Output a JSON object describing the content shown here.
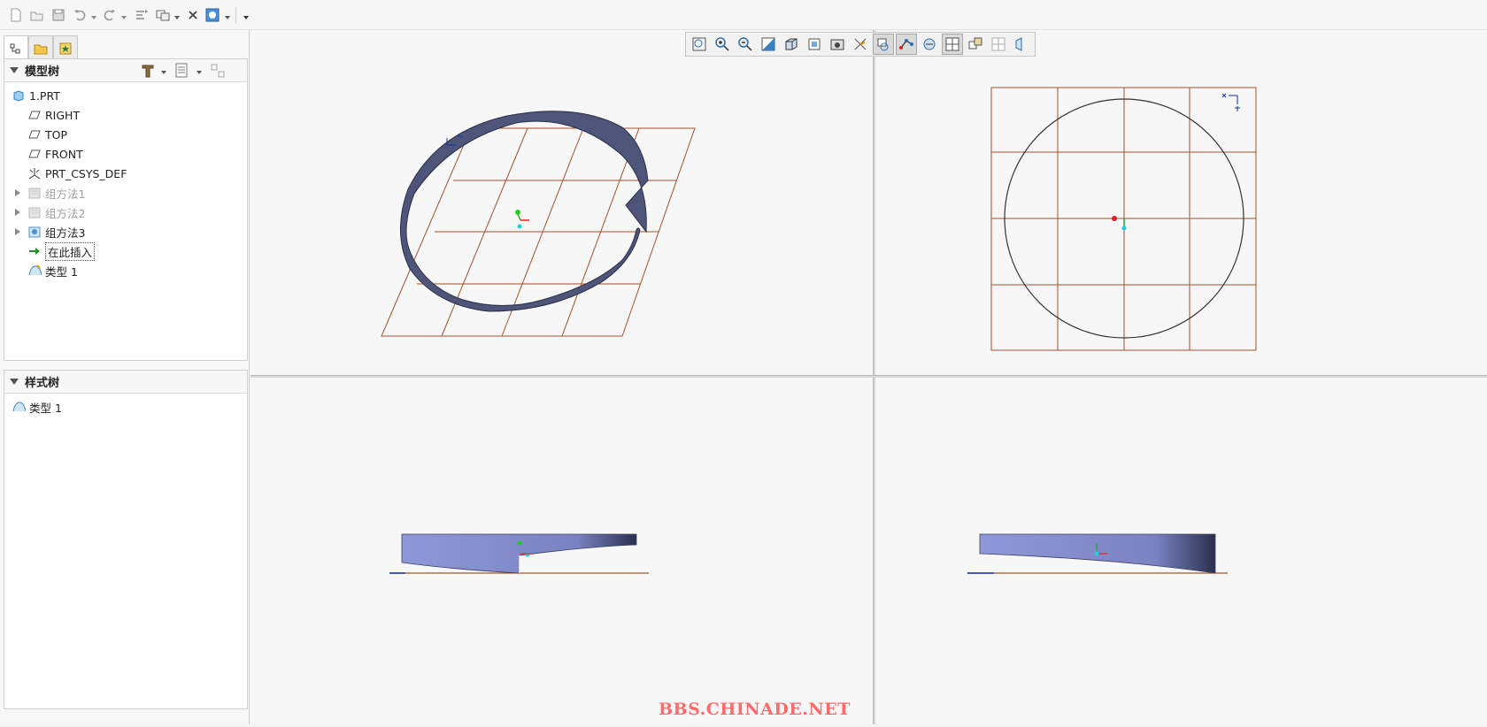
{
  "quick_access": {
    "icons": [
      "new-icon",
      "open-icon",
      "save-icon",
      "undo-icon",
      "redo-icon",
      "regenerate-icon",
      "windows-icon",
      "close-window-icon",
      "customize-icon"
    ]
  },
  "model_tree": {
    "title": "模型树",
    "items": [
      {
        "label": "1.PRT",
        "icon": "part-icon"
      },
      {
        "label": "RIGHT",
        "icon": "datum-plane-icon"
      },
      {
        "label": "TOP",
        "icon": "datum-plane-icon"
      },
      {
        "label": "FRONT",
        "icon": "datum-plane-icon"
      },
      {
        "label": "PRT_CSYS_DEF",
        "icon": "csys-icon"
      },
      {
        "label": "组方法1",
        "icon": "group-icon"
      },
      {
        "label": "组方法2",
        "icon": "group-icon"
      },
      {
        "label": "组方法3",
        "icon": "group-icon"
      },
      {
        "label": "在此插入",
        "icon": "insert-arrow-icon"
      },
      {
        "label": "类型 1",
        "icon": "style-icon"
      }
    ]
  },
  "style_tree": {
    "title": "样式树",
    "items": [
      {
        "label": "类型 1",
        "icon": "style-icon"
      }
    ]
  },
  "view_toolbar": {
    "buttons": [
      "refit-icon",
      "zoom-in-icon",
      "zoom-out-icon",
      "repaint-icon",
      "display-style-icon",
      "saved-views-icon",
      "named-view-icon",
      "datum-display-icon",
      "spin-center-icon",
      "annotation-display-icon",
      "view-manager-icon",
      "single-view-icon",
      "four-views-icon",
      "next-view-icon",
      "copy-view-icon",
      "flip-icon"
    ],
    "active": [
      "spin-center-icon",
      "annotation-display-icon",
      "four-views-icon"
    ]
  },
  "colors": {
    "grid": "#a0522d",
    "surface": "#4e5579",
    "surface_light": "#9aa3df",
    "circle": "#333333",
    "axis_label": "#1a2fb0"
  },
  "watermark": "BBS.CHINADE.NET"
}
